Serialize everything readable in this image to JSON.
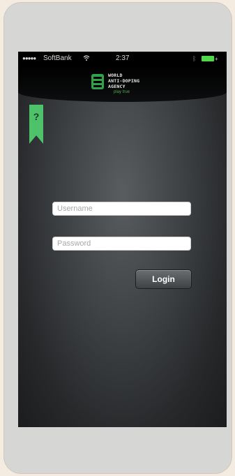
{
  "status_bar": {
    "signal": "●●●●●",
    "carrier": "SoftBank",
    "time": "2:37",
    "battery_color": "#4fd84a"
  },
  "header": {
    "logo_lines": [
      "WORLD",
      "ANTI-DOPING",
      "AGENCY"
    ],
    "tagline": "play true",
    "logo_color": "#2fa34b"
  },
  "help": {
    "label": "?",
    "ribbon_color": "#4ec26a"
  },
  "login_form": {
    "username_placeholder": "Username",
    "password_placeholder": "Password",
    "username_value": "",
    "password_value": "",
    "login_label": "Login"
  }
}
